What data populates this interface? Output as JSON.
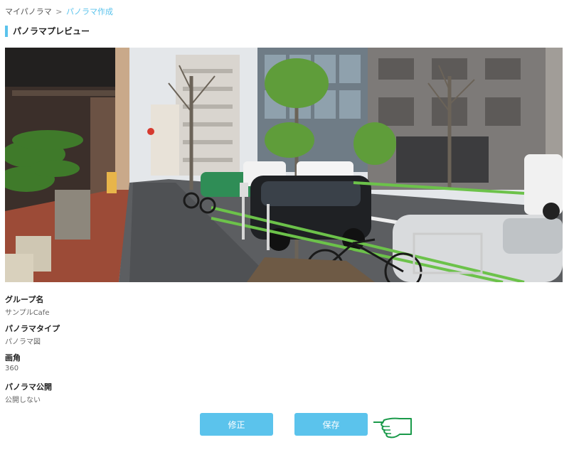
{
  "breadcrumb": {
    "items": [
      "マイパノラマ",
      "パノラマ作成"
    ],
    "separator": ">"
  },
  "section": {
    "title": "パノラマプレビュー"
  },
  "preview": {
    "image_icon": "street-panorama-photo"
  },
  "fields": [
    {
      "label": "グループ名",
      "value": "サンプルCafe"
    },
    {
      "label": "パノラマタイプ",
      "value": "パノラマ図"
    },
    {
      "label": "画角",
      "value": "360"
    },
    {
      "label": "パノラマ公開",
      "value": "公開しない"
    }
  ],
  "actions": {
    "edit_label": "修正",
    "save_label": "保存",
    "pointer_icon": "pointing-hand-icon"
  },
  "colors": {
    "accent": "#5bc3ec",
    "pointer": "#1a9a4a"
  }
}
